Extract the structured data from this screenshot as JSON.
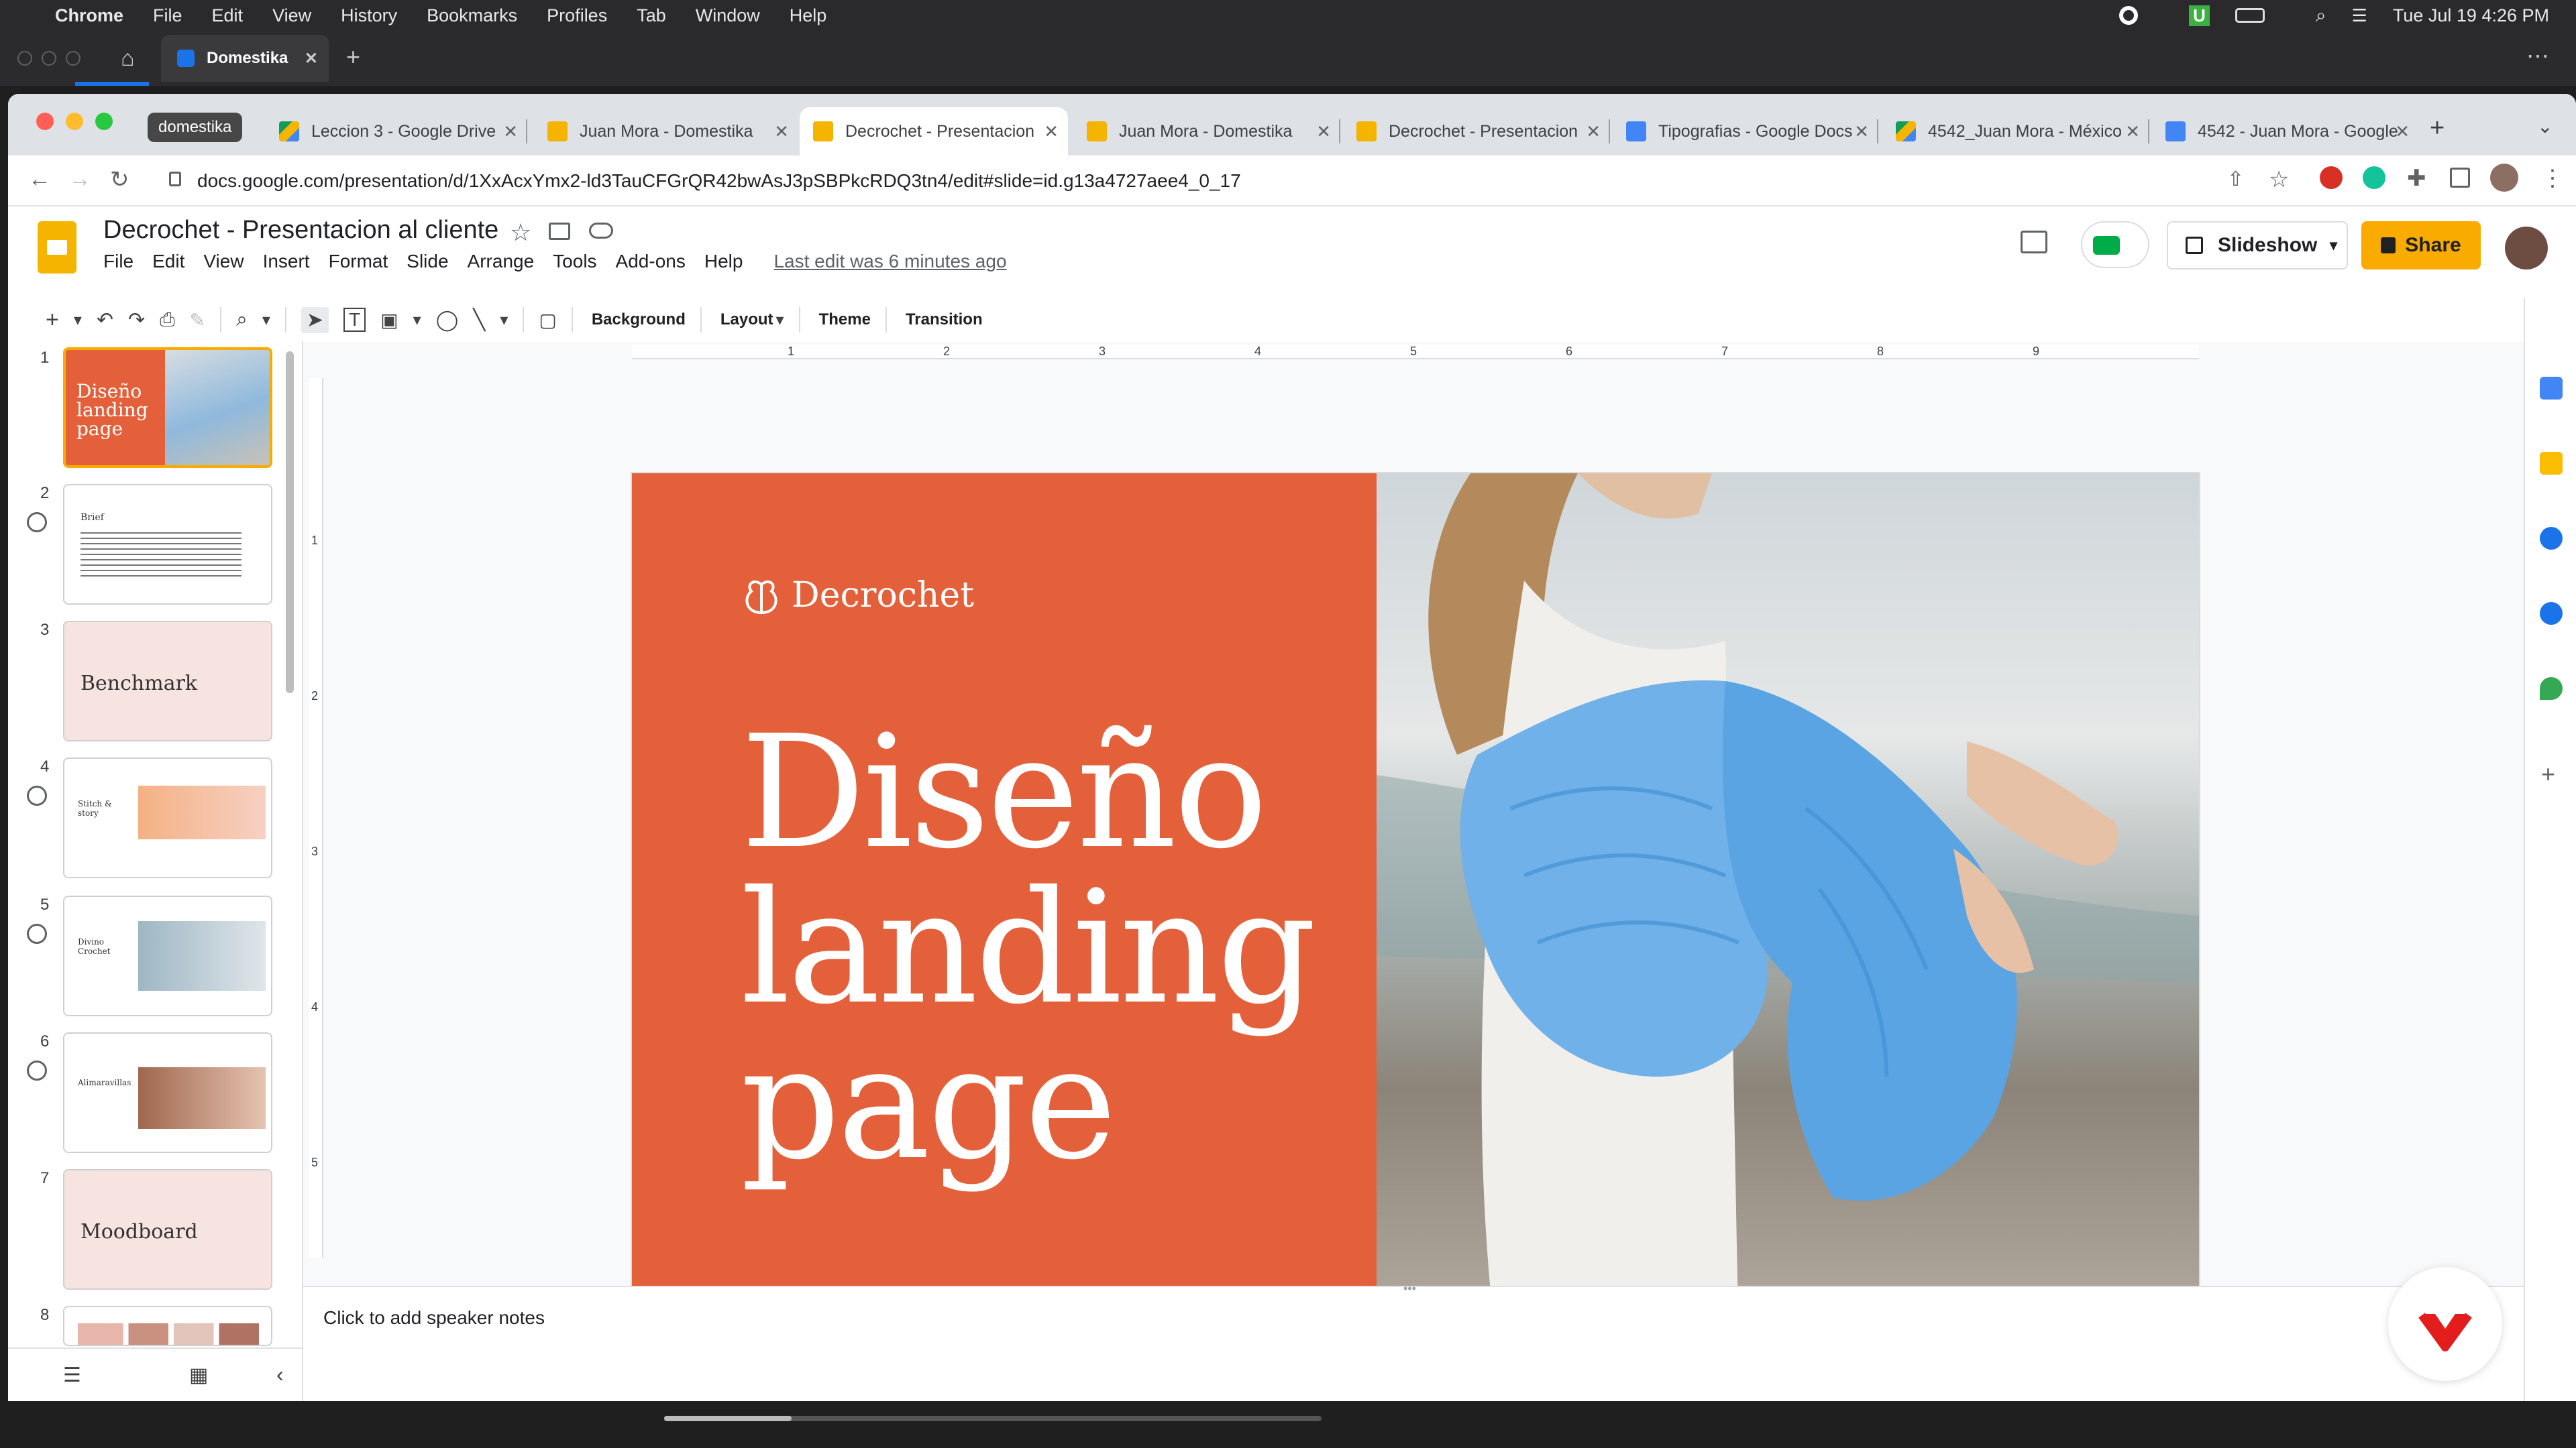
{
  "mac_menubar": {
    "app_name": "Chrome",
    "items": [
      "File",
      "Edit",
      "View",
      "History",
      "Bookmarks",
      "Profiles",
      "Tab",
      "Window",
      "Help"
    ],
    "datetime": "Tue Jul 19  4:26 PM"
  },
  "recorder": {
    "tab_title": "Domestika"
  },
  "browser": {
    "tab_group": "domestika",
    "tabs": [
      {
        "title": "Leccion 3 - Google Drive",
        "favicon": "drive-icon"
      },
      {
        "title": "Juan Mora - Domestika",
        "favicon": "slides-icon"
      },
      {
        "title": "Decrochet - Presentacion",
        "favicon": "slides-icon",
        "active": true
      },
      {
        "title": "Juan Mora - Domestika",
        "favicon": "slides-icon"
      },
      {
        "title": "Decrochet - Presentacion",
        "favicon": "slides-icon"
      },
      {
        "title": "Tipografias - Google Docs",
        "favicon": "docs-icon"
      },
      {
        "title": "4542_Juan Mora - México",
        "favicon": "drive-icon"
      },
      {
        "title": "4542 - Juan Mora - Google",
        "favicon": "docs-icon"
      }
    ],
    "url": "docs.google.com/presentation/d/1XxAcxYmx2-ld3TauCFGrQR42bwAsJ3pSBPkcRDQ3tn4/edit#slide=id.g13a4727aee4_0_17"
  },
  "docs": {
    "title": "Decrochet - Presentacion al cliente",
    "menu": [
      "File",
      "Edit",
      "View",
      "Insert",
      "Format",
      "Slide",
      "Arrange",
      "Tools",
      "Add-ons",
      "Help"
    ],
    "last_edit": "Last edit was 6 minutes ago",
    "slideshow_label": "Slideshow",
    "share_label": "Share"
  },
  "toolbar": {
    "background": "Background",
    "layout": "Layout",
    "theme": "Theme",
    "transition": "Transition"
  },
  "ruler": {
    "h_ticks": [
      "1",
      "2",
      "3",
      "4",
      "5",
      "6",
      "7",
      "8",
      "9"
    ],
    "v_ticks": [
      "1",
      "2",
      "3",
      "4",
      "5"
    ]
  },
  "filmstrip": [
    {
      "num": "1",
      "title": "Diseño landing page",
      "style": "cover"
    },
    {
      "num": "2",
      "title": "Brief",
      "style": "text"
    },
    {
      "num": "3",
      "title": "Benchmark",
      "style": "section"
    },
    {
      "num": "4",
      "title": "Stitch & story",
      "style": "layout"
    },
    {
      "num": "5",
      "title": "Divino Crochet",
      "style": "layout"
    },
    {
      "num": "6",
      "title": "Alimaravillas",
      "style": "layout"
    },
    {
      "num": "7",
      "title": "Moodboard",
      "style": "section"
    },
    {
      "num": "8",
      "title": "",
      "style": "grid"
    }
  ],
  "slide": {
    "brand": "Decrochet",
    "headline": [
      "Diseño",
      "landing",
      "page"
    ],
    "accent_color": "#e4603b"
  },
  "notes_placeholder": "Click to add speaker notes",
  "colors": {
    "brand_orange": "#e4603b",
    "share_yellow": "#f9ab00",
    "slides_yellow": "#f4b400"
  }
}
